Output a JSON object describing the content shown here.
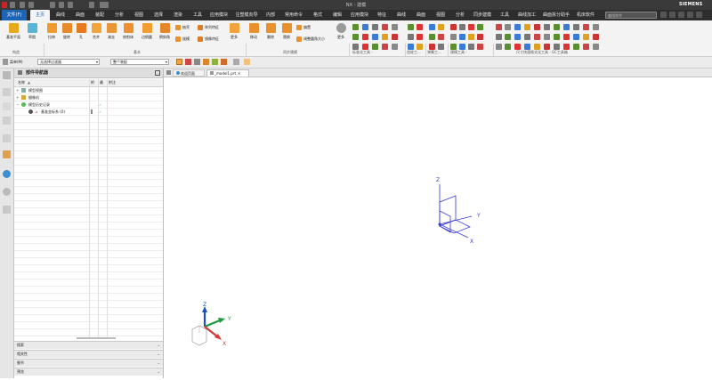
{
  "window": {
    "title": "NX - 建模",
    "brand": "SIEMENS"
  },
  "menu": {
    "file": "文件(F)",
    "tabs": [
      "主页",
      "曲线",
      "曲面",
      "装配",
      "分析",
      "视图",
      "选择",
      "渲染",
      "工具",
      "应用模块",
      "注塑模向导",
      "内部",
      "常用命令",
      "格式",
      "编辑",
      "应用模块",
      "特征",
      "曲线",
      "曲面",
      "视图",
      "分析",
      "同步建模",
      "工具",
      "曲线加工",
      "曲面拆分助手",
      "机床软件"
    ],
    "search_placeholder": "查找命令"
  },
  "ribbon": {
    "big_buttons": [
      "基准平面",
      "草图",
      "拉伸",
      "旋转",
      "孔",
      "合并",
      "减去",
      "修剪体",
      "边倒圆",
      "倒斜角"
    ],
    "small_buttons": [
      "抽壳",
      "拔模",
      "阵列特征",
      "镜像特征",
      "更多",
      "移动",
      "删除",
      "替换",
      "调整圆角大小",
      "偏置",
      "更多"
    ],
    "groups": [
      "构造",
      "基本",
      "同步建模",
      "标准化工具 -",
      "齿轮工...",
      "弹簧工...",
      "建模工具 -",
      "尺寸快速格式化工具 - GC工具箱"
    ]
  },
  "toolbar2": {
    "menu": "菜单(M)",
    "filter": "无选择过滤器",
    "scope": "整个装配"
  },
  "navigator": {
    "title": "部件导航器",
    "columns": [
      "名称",
      "附",
      "最",
      "附注"
    ],
    "rows": [
      {
        "label": "模型视图",
        "level": 1
      },
      {
        "label": "摄像机",
        "level": 1
      },
      {
        "label": "模型历史记录",
        "level": 1
      },
      {
        "label": "基准坐标系 (0)",
        "level": 2
      }
    ],
    "accordion": [
      "搜索",
      "相关性",
      "细节",
      "预览"
    ]
  },
  "tabs": {
    "welcome": "欢迎页面",
    "model": "_model1.prt"
  },
  "axes": {
    "x": "X",
    "y": "Y",
    "z": "Z"
  },
  "colors": {
    "accent": "#1e64b4",
    "titlebar": "#3a3a3a",
    "ribbon": "#f3f3f3",
    "axis": "#3a3ad8"
  }
}
